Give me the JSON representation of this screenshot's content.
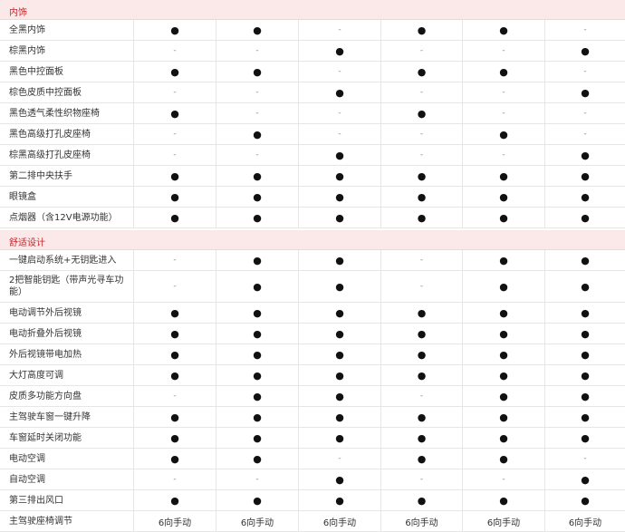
{
  "symbols": {
    "standard": "●",
    "none": "-"
  },
  "sections": [
    {
      "title": "内饰",
      "rows": [
        {
          "label": "全黑内饰",
          "values": [
            "●",
            "●",
            "-",
            "●",
            "●",
            "-"
          ]
        },
        {
          "label": "棕黑内饰",
          "values": [
            "-",
            "-",
            "●",
            "-",
            "-",
            "●"
          ]
        },
        {
          "label": "黑色中控面板",
          "values": [
            "●",
            "●",
            "-",
            "●",
            "●",
            "-"
          ]
        },
        {
          "label": "棕色皮质中控面板",
          "values": [
            "-",
            "-",
            "●",
            "-",
            "-",
            "●"
          ]
        },
        {
          "label": "黑色透气柔性织物座椅",
          "values": [
            "●",
            "-",
            "-",
            "●",
            "-",
            "-"
          ]
        },
        {
          "label": "黑色高级打孔皮座椅",
          "values": [
            "-",
            "●",
            "-",
            "-",
            "●",
            "-"
          ]
        },
        {
          "label": "棕黑高级打孔皮座椅",
          "values": [
            "-",
            "-",
            "●",
            "-",
            "-",
            "●"
          ]
        },
        {
          "label": "第二排中央扶手",
          "values": [
            "●",
            "●",
            "●",
            "●",
            "●",
            "●"
          ]
        },
        {
          "label": "眼镜盒",
          "values": [
            "●",
            "●",
            "●",
            "●",
            "●",
            "●"
          ]
        },
        {
          "label": "点烟器（含12V电源功能）",
          "values": [
            "●",
            "●",
            "●",
            "●",
            "●",
            "●"
          ]
        }
      ]
    },
    {
      "title": "舒适设计",
      "rows": [
        {
          "label": "一键启动系统+无钥匙进入",
          "values": [
            "-",
            "●",
            "●",
            "-",
            "●",
            "●"
          ]
        },
        {
          "label": "2把智能钥匙（带声光寻车功能）",
          "values": [
            "-",
            "●",
            "●",
            "-",
            "●",
            "●"
          ]
        },
        {
          "label": "电动调节外后视镜",
          "values": [
            "●",
            "●",
            "●",
            "●",
            "●",
            "●"
          ]
        },
        {
          "label": "电动折叠外后视镜",
          "values": [
            "●",
            "●",
            "●",
            "●",
            "●",
            "●"
          ]
        },
        {
          "label": "外后视镜带电加热",
          "values": [
            "●",
            "●",
            "●",
            "●",
            "●",
            "●"
          ]
        },
        {
          "label": "大灯高度可调",
          "values": [
            "●",
            "●",
            "●",
            "●",
            "●",
            "●"
          ]
        },
        {
          "label": "皮质多功能方向盘",
          "values": [
            "-",
            "●",
            "●",
            "-",
            "●",
            "●"
          ]
        },
        {
          "label": "主驾驶车窗一键升降",
          "values": [
            "●",
            "●",
            "●",
            "●",
            "●",
            "●"
          ]
        },
        {
          "label": "车窗延时关闭功能",
          "values": [
            "●",
            "●",
            "●",
            "●",
            "●",
            "●"
          ]
        },
        {
          "label": "电动空调",
          "values": [
            "●",
            "●",
            "-",
            "●",
            "●",
            "-"
          ]
        },
        {
          "label": "自动空调",
          "values": [
            "-",
            "-",
            "●",
            "-",
            "-",
            "●"
          ]
        },
        {
          "label": "第三排出风口",
          "values": [
            "●",
            "●",
            "●",
            "●",
            "●",
            "●"
          ]
        },
        {
          "label": "主驾驶座椅调节",
          "values": [
            "6向手动",
            "6向手动",
            "6向手动",
            "6向手动",
            "6向手动",
            "6向手动"
          ]
        }
      ]
    }
  ]
}
